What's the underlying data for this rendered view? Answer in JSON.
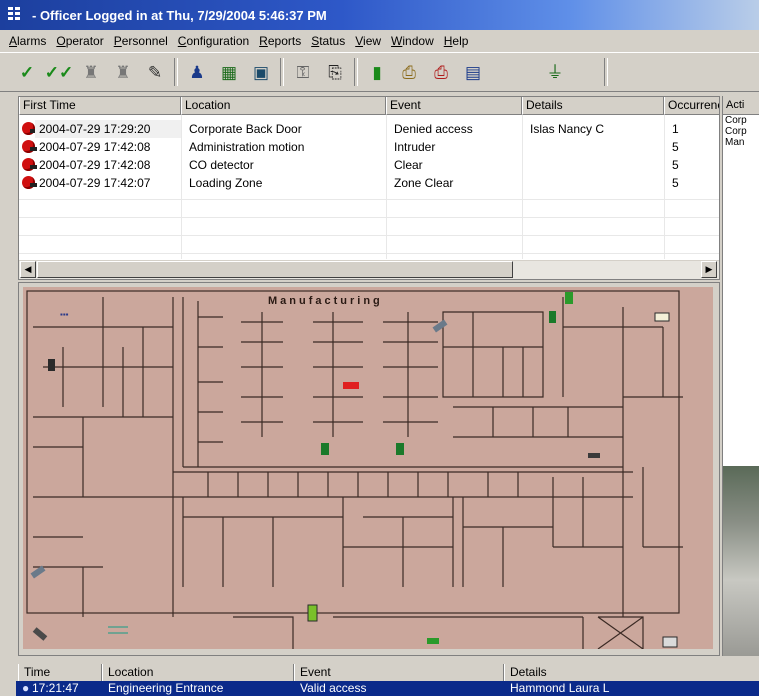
{
  "window": {
    "title": "- Officer Logged in at  Thu, 7/29/2004 5:46:37 PM"
  },
  "menu": [
    {
      "u": "A",
      "rest": "larms"
    },
    {
      "u": "O",
      "rest": "perator"
    },
    {
      "u": "P",
      "rest": "ersonnel"
    },
    {
      "u": "C",
      "rest": "onfiguration"
    },
    {
      "u": "R",
      "rest": "eports"
    },
    {
      "u": "S",
      "rest": "tatus"
    },
    {
      "u": "V",
      "rest": "iew"
    },
    {
      "u": "W",
      "rest": "indow"
    },
    {
      "u": "H",
      "rest": "elp"
    }
  ],
  "toolbar_icons": [
    "acknowledge-icon",
    "acknowledge-all-icon",
    "clear-icon",
    "clear-all-icon",
    "pen-icon",
    "person-icon",
    "cardholder-icon",
    "monitor-icon",
    "key-icon",
    "door-icon",
    "exit-icon",
    "print-icon",
    "print-red-icon",
    "report-icon",
    "network-icon"
  ],
  "alarms": {
    "columns": [
      "First Time",
      "Location",
      "Event",
      "Details",
      "Occurrences"
    ],
    "rows": [
      {
        "time": "2004-07-29 17:29:20",
        "location": "Corporate Back Door",
        "event": "Denied access",
        "details": "Islas Nancy C",
        "count": "1"
      },
      {
        "time": "2004-07-29 17:42:08",
        "location": "Administration motion",
        "event": "Intruder",
        "details": "",
        "count": "5"
      },
      {
        "time": "2004-07-29 17:42:08",
        "location": "CO detector",
        "event": "Clear",
        "details": "",
        "count": "5"
      },
      {
        "time": "2004-07-29 17:42:07",
        "location": "Loading Zone",
        "event": "Zone Clear",
        "details": "",
        "count": "5"
      }
    ]
  },
  "activity": {
    "header": "Acti",
    "lines": [
      "Corp",
      "Corp",
      "Man"
    ]
  },
  "map": {
    "title": "Manufacturing"
  },
  "events": {
    "columns": [
      "Time",
      "Location",
      "Event",
      "Details"
    ],
    "row": {
      "time": "17:21:47",
      "location": "Engineering Entrance",
      "event": "Valid access",
      "details": "Hammond Laura L"
    }
  },
  "colors": {
    "map_floor": "#cba79c",
    "alarm_red": "#d01010",
    "selection": "#0b2a8a"
  }
}
